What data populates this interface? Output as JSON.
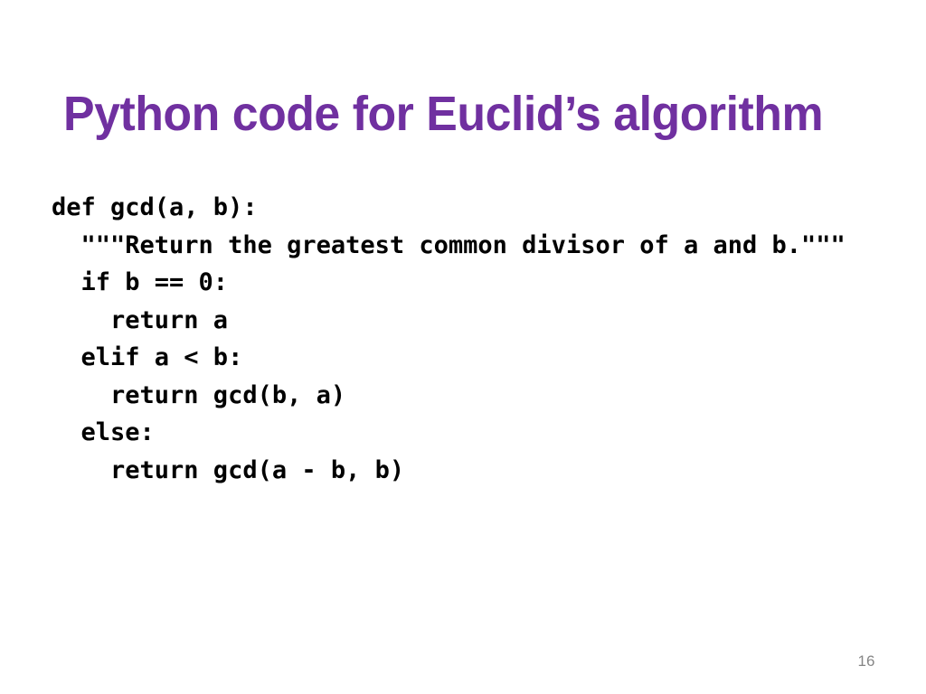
{
  "slide": {
    "title": "Python code for Euclid’s algorithm",
    "title_color": "#7030A0",
    "background_color": "#FFFFFF",
    "page_number": "16",
    "page_number_color": "#868686",
    "code_color": "#000000",
    "code": {
      "language": "python",
      "lines": [
        "def gcd(a, b):",
        "  \"\"\"Return the greatest common divisor of a and b.\"\"\"",
        "  if b == 0:",
        "    return a",
        "  elif a < b:",
        "    return gcd(b, a)",
        "  else:",
        "    return gcd(a - b, b)"
      ],
      "full_text": "def gcd(a, b):\n  \"\"\"Return the greatest common divisor of a and b.\"\"\"\n  if b == 0:\n    return a\n  elif a < b:\n    return gcd(b, a)\n  else:\n    return gcd(a - b, b)"
    }
  }
}
